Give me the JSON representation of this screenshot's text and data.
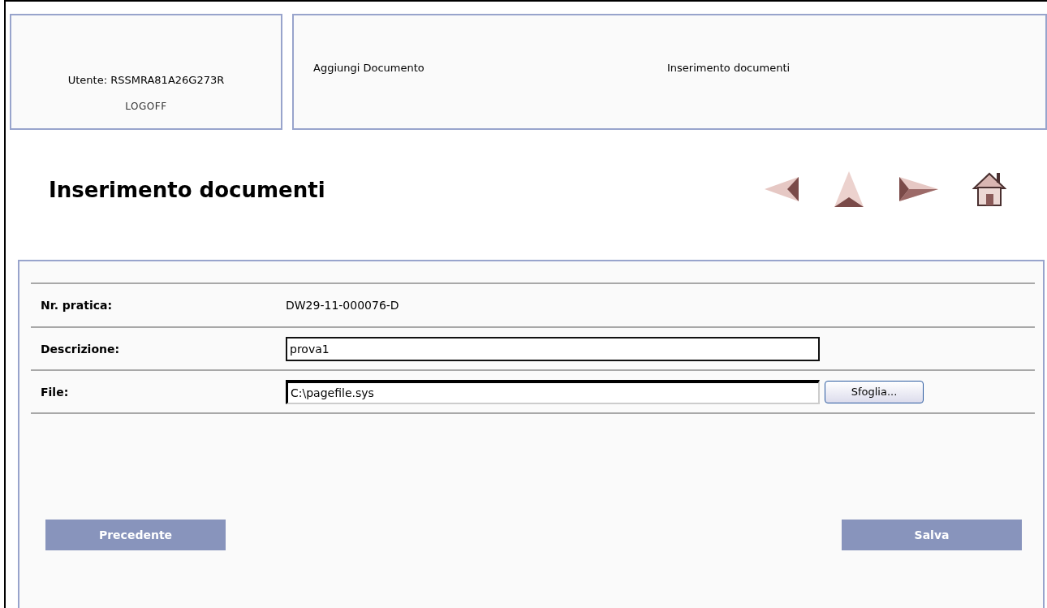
{
  "header": {
    "user": "Utente: RSSMRA81A26G273R",
    "logoff": "LOGOFF",
    "section": "Aggiungi Documento",
    "subsection": "Inserimento documenti"
  },
  "title": "Inserimento documenti",
  "form": {
    "rows": [
      {
        "kind": "text",
        "label": "Nr. pratica:",
        "value": "DW29-11-000076-D"
      },
      {
        "kind": "input",
        "label": "Descrizione:",
        "value": "prova1"
      },
      {
        "kind": "file",
        "label": "File:",
        "value": "C:\\pagefile.sys",
        "button": "Sfoglia..."
      }
    ]
  },
  "buttons": {
    "back": "Precedente",
    "save": "Salva"
  }
}
